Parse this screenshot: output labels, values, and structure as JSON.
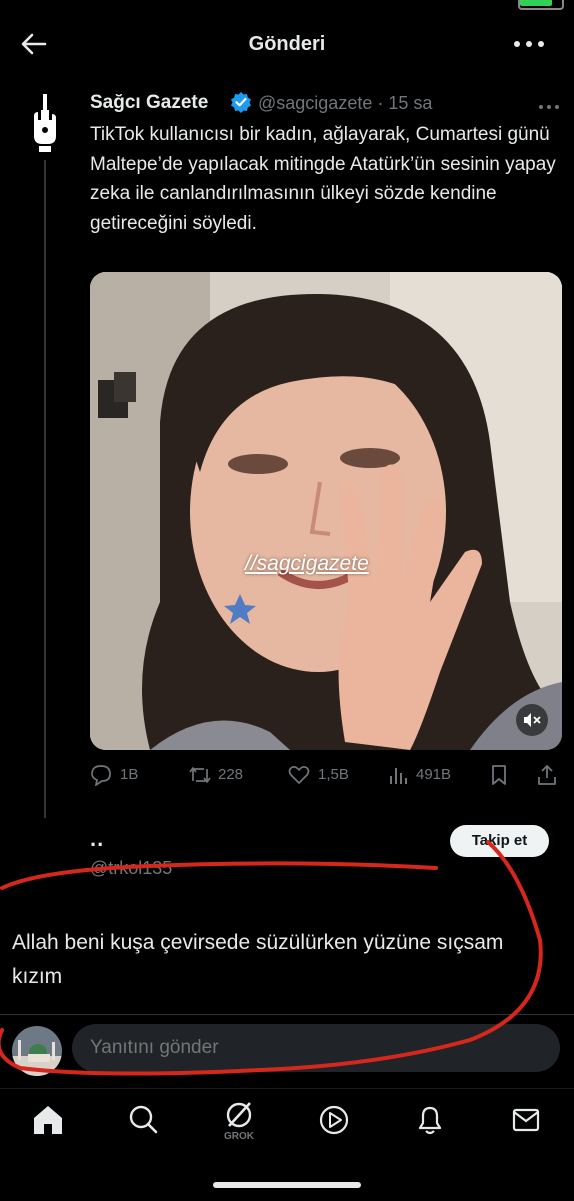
{
  "header": {
    "title": "Gönderi",
    "back_icon": "back-arrow-icon",
    "more_icon": "more-horizontal-icon"
  },
  "post": {
    "author": "Sağcı Gazete",
    "handle_time": "@sagcigazete · 15 sa",
    "text": "TikTok kullanıcısı bir kadın, ağlayarak, Cumartesi günü Maltepe’de yapılacak mitingde Atatürk’ün sesinin yapay zeka ile canlandırılmasının ülkeyi sözde kendine getireceğini söyledi.",
    "media_watermark": "//sagcigazete",
    "actions": {
      "replies": "1B",
      "reposts": "228",
      "likes": "1,5B",
      "views": "491B"
    }
  },
  "reply": {
    "name": "..",
    "handle": "@trkol135",
    "follow_label": "Takip et",
    "text": "Allah beni kuşa çevirsede süzülürken yüzüne sıçsam kızım"
  },
  "composer": {
    "placeholder": "Yanıtını gönder"
  },
  "tabbar": {
    "grok_label": "GROK"
  },
  "colors": {
    "accent": "#1d9bf0",
    "annotation": "#d6271c",
    "battery": "#2fd158"
  }
}
